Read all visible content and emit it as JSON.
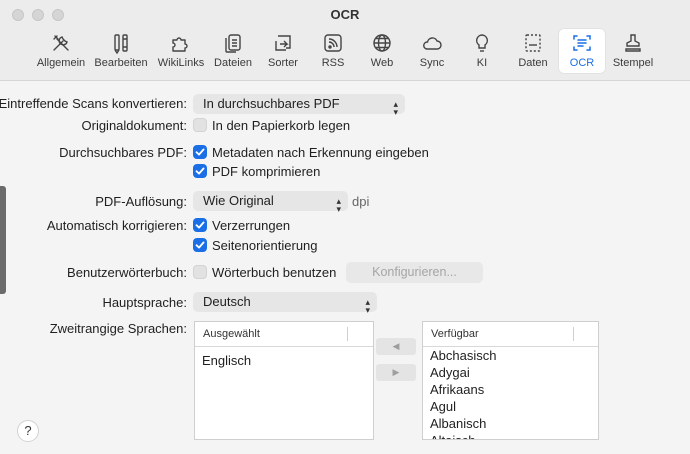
{
  "window": {
    "title": "OCR"
  },
  "toolbar": {
    "items": [
      {
        "label": "Allgemein",
        "icon": "tools-icon"
      },
      {
        "label": "Bearbeiten",
        "icon": "pencil-icon"
      },
      {
        "label": "WikiLinks",
        "icon": "puzzle-icon"
      },
      {
        "label": "Dateien",
        "icon": "files-icon"
      },
      {
        "label": "Sorter",
        "icon": "sorter-icon"
      },
      {
        "label": "RSS",
        "icon": "rss-icon"
      },
      {
        "label": "Web",
        "icon": "globe-icon"
      },
      {
        "label": "Sync",
        "icon": "cloud-icon"
      },
      {
        "label": "KI",
        "icon": "lightbulb-icon"
      },
      {
        "label": "Daten",
        "icon": "data-icon"
      },
      {
        "label": "OCR",
        "icon": "ocr-icon",
        "active": true
      },
      {
        "label": "Stempel",
        "icon": "stamp-icon"
      }
    ],
    "accent": "#1a6ee6"
  },
  "form": {
    "incoming_label": "Eintreffende Scans konvertieren:",
    "incoming_value": "In durchsuchbares PDF",
    "original_label": "Originaldokument:",
    "original_option": "In den Papierkorb legen",
    "searchable_label": "Durchsuchbares PDF:",
    "metadata_option": "Metadaten nach Erkennung eingeben",
    "compress_option": "PDF komprimieren",
    "resolution_label": "PDF-Auflösung:",
    "resolution_value": "Wie Original",
    "resolution_unit": "dpi",
    "autocorrect_label": "Automatisch korrigieren:",
    "distortion_option": "Verzerrungen",
    "orientation_option": "Seitenorientierung",
    "dictionary_label": "Benutzerwörterbuch:",
    "dictionary_option": "Wörterbuch benutzen",
    "configure_button": "Konfigurieren...",
    "main_language_label": "Hauptsprache:",
    "main_language_value": "Deutsch",
    "secondary_label": "Zweitrangige Sprachen:"
  },
  "checkboxes": {
    "original_trash": false,
    "metadata": true,
    "compress": true,
    "distortion": true,
    "orientation": true,
    "dictionary": false
  },
  "selected_list": {
    "header": "Ausgewählt",
    "items": [
      "Englisch"
    ]
  },
  "available_list": {
    "header": "Verfügbar",
    "items": [
      "Abchasisch",
      "Adygai",
      "Afrikaans",
      "Agul",
      "Albanisch",
      "Altaisch"
    ]
  },
  "arrows": {
    "left": "◀",
    "right": "▶"
  },
  "help": {
    "label": "?"
  }
}
